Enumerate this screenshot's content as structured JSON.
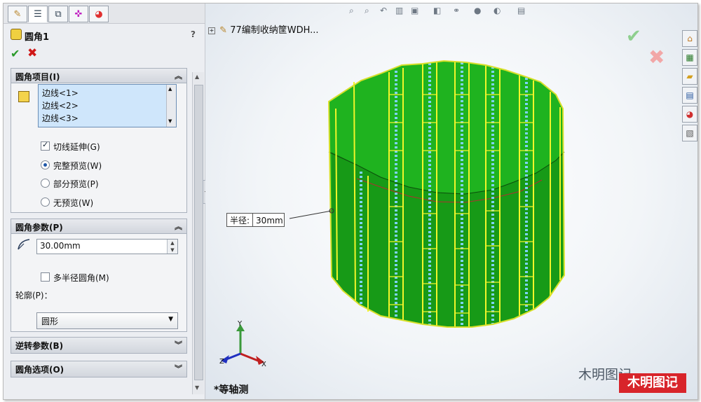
{
  "feature_tabs": [
    "feature-manager",
    "property-manager",
    "configuration-manager",
    "dimxpert-manager",
    "display-manager"
  ],
  "panel": {
    "title": "圆角1",
    "help": "?",
    "ok_symbol": "✔",
    "cancel_symbol": "✖",
    "fillet_items": {
      "header": "圆角项目(I)",
      "edges": [
        "边线<1>",
        "边线<2>",
        "边线<3>"
      ],
      "tangent_propagation": "切线延伸(G)",
      "full_preview": "完整预览(W)",
      "partial_preview": "部分预览(P)",
      "no_preview": "无预览(W)"
    },
    "fillet_params": {
      "header": "圆角参数(P)",
      "radius_value": "30.00mm",
      "multi_radius": "多半径圆角(M)",
      "profile_label": "轮廓(P)：",
      "profile_value": "圆形"
    },
    "reverse_params": {
      "header": "逆转参数(B)"
    },
    "fillet_options": {
      "header": "圆角选项(O)"
    }
  },
  "view": {
    "tree_label": "77编制收纳筐WDH...",
    "callout_key": "半径:",
    "callout_value": "30mm",
    "view_name": "*等轴测",
    "watermark": "木明图记",
    "stamp": "木明图记",
    "triad_labels": {
      "y": "Y",
      "x": "X",
      "z": "Z"
    }
  },
  "colors": {
    "accent": "#1f57a8",
    "model_green": "#1fb31f",
    "edge_yellow": "#f2f52a",
    "ok_green": "#2a9a2a",
    "cancel_red": "#d01818"
  }
}
